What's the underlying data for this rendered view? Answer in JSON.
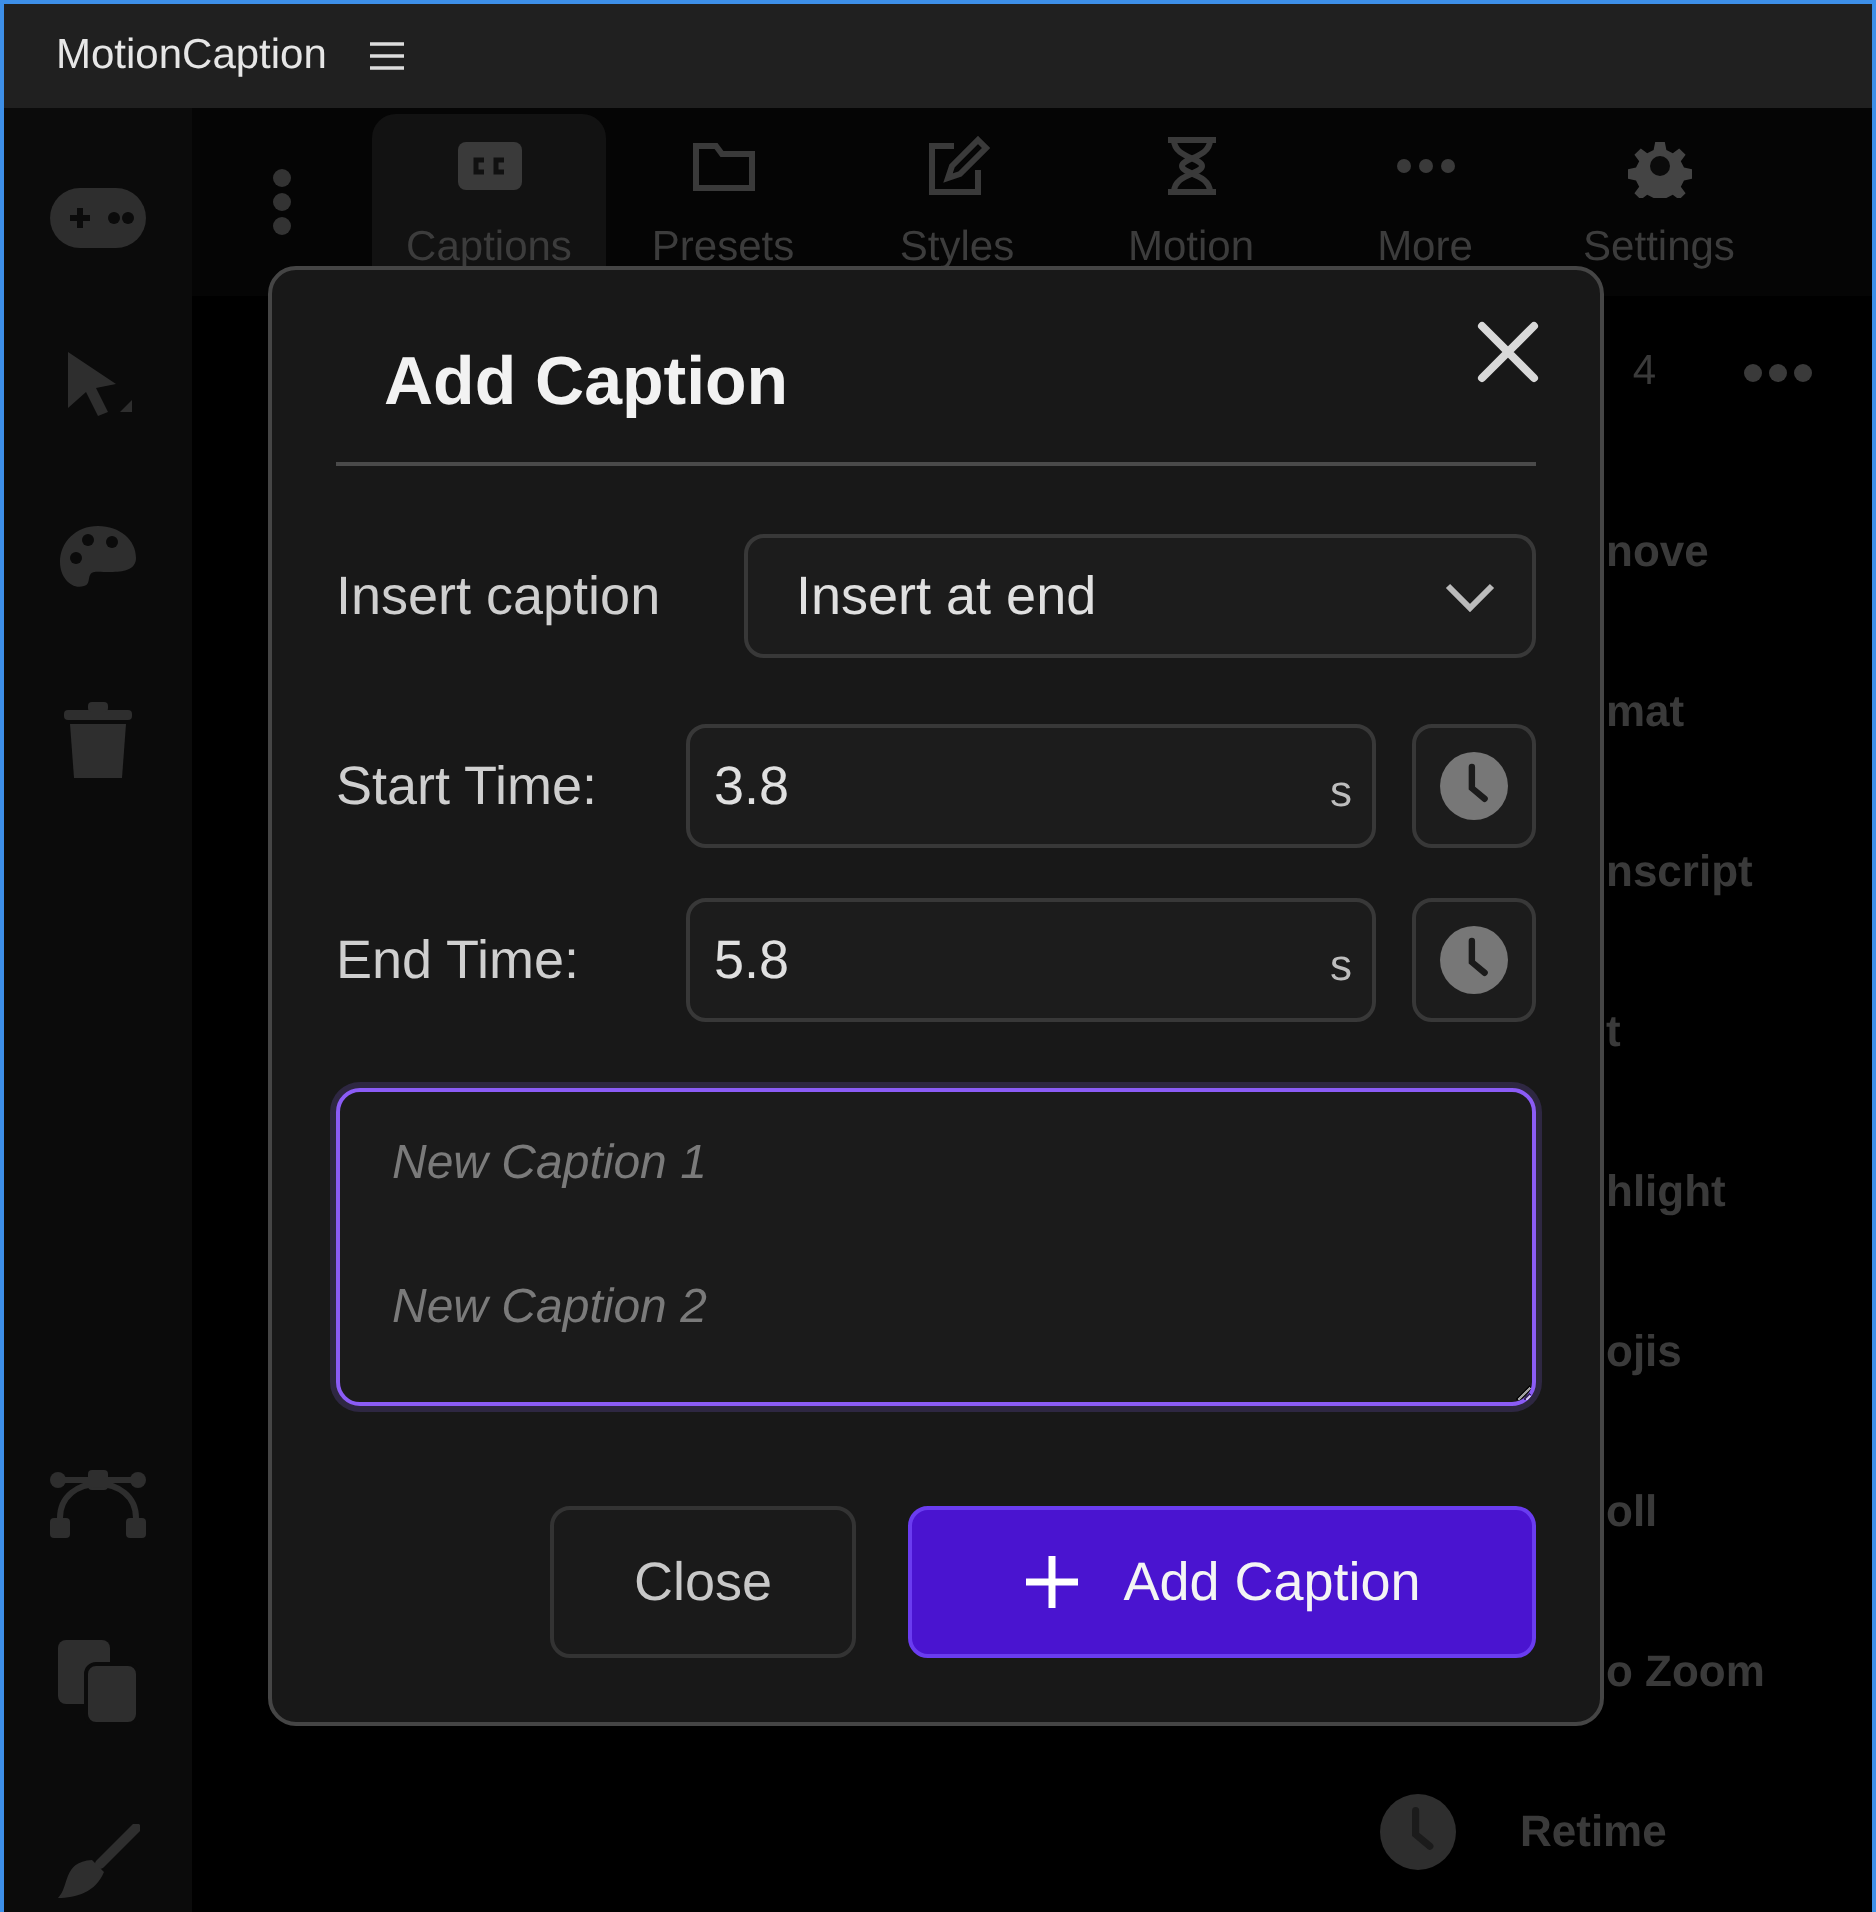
{
  "window": {
    "title": "MotionCaption"
  },
  "tabs": [
    {
      "label": "Captions",
      "kind": "cc",
      "selected": true
    },
    {
      "label": "Presets",
      "kind": "folder",
      "selected": false
    },
    {
      "label": "Styles",
      "kind": "pencil",
      "selected": false
    },
    {
      "label": "Motion",
      "kind": "hourglass",
      "selected": false
    },
    {
      "label": "More",
      "kind": "dots",
      "selected": false
    },
    {
      "label": "Settings",
      "kind": "gear",
      "selected": false
    }
  ],
  "toolbar": {
    "count": "4"
  },
  "list": [
    {
      "label": "nove",
      "kind": "covered"
    },
    {
      "label": "mat",
      "kind": "covered"
    },
    {
      "label": "nscript",
      "kind": "covered"
    },
    {
      "label": "t",
      "kind": "covered"
    },
    {
      "label": "hlight",
      "kind": "covered"
    },
    {
      "label": "ojis",
      "kind": "covered"
    },
    {
      "label": "oll",
      "kind": "covered"
    },
    {
      "label": "o Zoom",
      "kind": "covered"
    },
    {
      "label": "Retime",
      "kind": "full"
    }
  ],
  "dialog": {
    "title": "Add Caption",
    "insert": {
      "label": "Insert caption",
      "value": "Insert at end"
    },
    "times": [
      {
        "label": "Start Time:",
        "value": "3.8",
        "unit": "s"
      },
      {
        "label": "End Time:",
        "value": "5.8",
        "unit": "s"
      }
    ],
    "caption": {
      "placeholder": "New Caption 1\n\nNew Caption 2",
      "focused": true
    },
    "buttons": [
      {
        "label": "Close",
        "kind": "secondary"
      },
      {
        "label": "Add Caption",
        "kind": "primary"
      }
    ]
  }
}
